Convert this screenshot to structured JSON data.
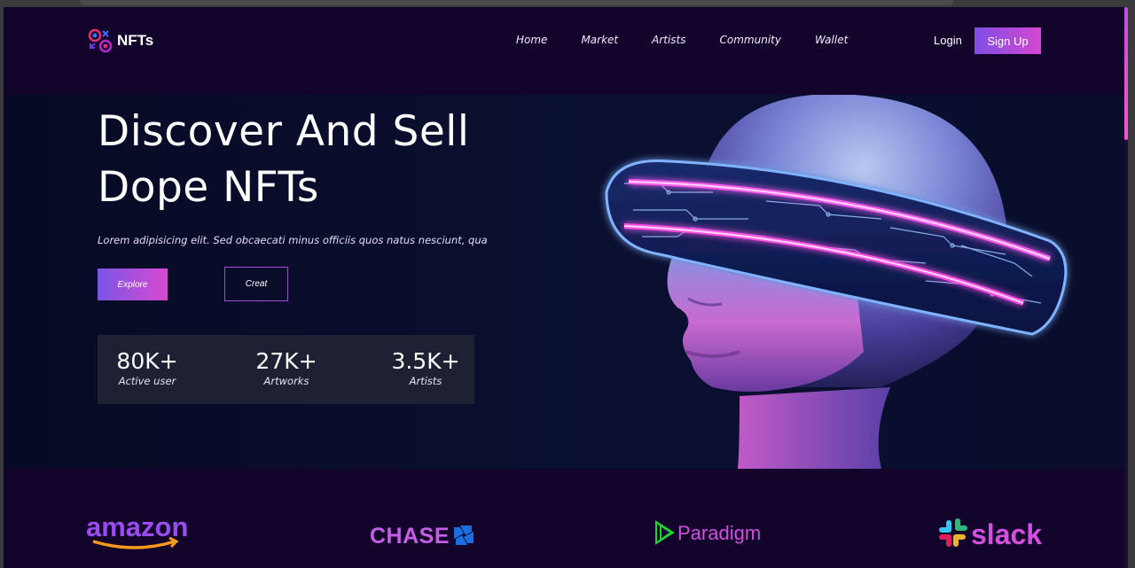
{
  "header": {
    "logo_text": "NFTs",
    "nav": [
      "Home",
      "Market",
      "Artists",
      "Community",
      "Wallet"
    ],
    "login_label": "Login",
    "signup_label": "Sign Up"
  },
  "hero": {
    "title_line1": "Discover And Sell",
    "title_line2": "Dope NFTs",
    "subtitle": "Lorem adipisicing elit. Sed obcaecati minus officiis quos natus nesciunt, qua",
    "explore_label": "Explore",
    "create_label": "Creat",
    "stats": [
      {
        "value": "80K+",
        "label": "Active user"
      },
      {
        "value": "27K+",
        "label": "Artworks"
      },
      {
        "value": "3.5K+",
        "label": "Artists"
      }
    ]
  },
  "brands": [
    "amazon",
    "CHASE",
    "Paradigm",
    "slack"
  ],
  "colors": {
    "background": "#12042a",
    "accent_start": "#7b55e6",
    "accent_end": "#d84ad2",
    "stats_bg": "#1e2033"
  }
}
